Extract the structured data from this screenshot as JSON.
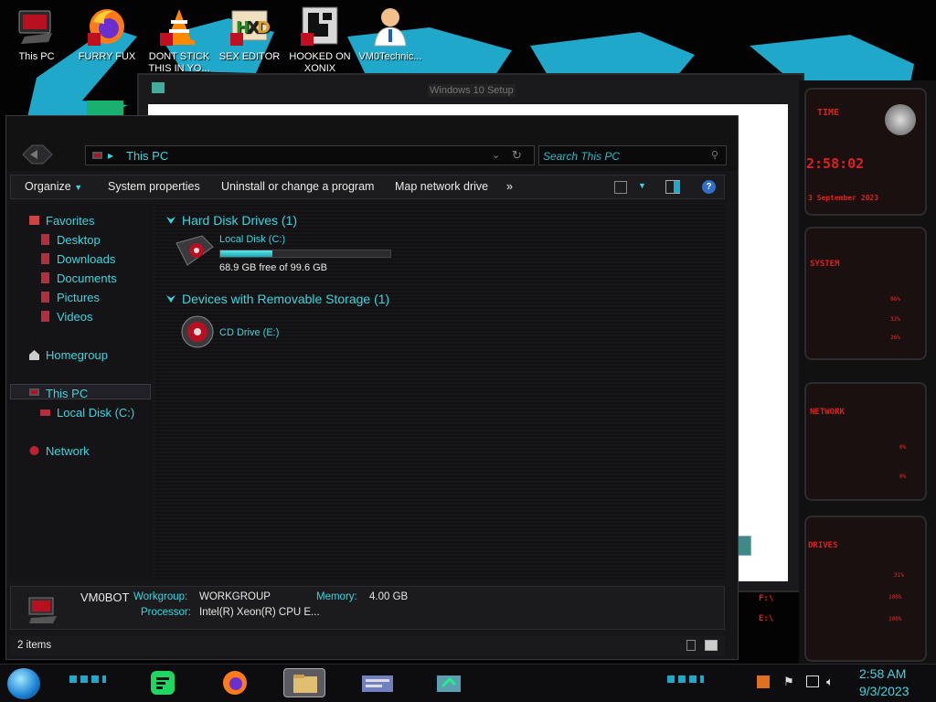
{
  "desktop": {
    "icons": [
      {
        "label": "This PC"
      },
      {
        "label": "FURRY FUX"
      },
      {
        "label": "DONT STICK THIS IN YO..."
      },
      {
        "label": "SEX EDITOR"
      },
      {
        "label": "HOOKED ON XONIX"
      },
      {
        "label": "VM0Technic..."
      }
    ]
  },
  "setup_window": {
    "title": "Windows 10 Setup"
  },
  "gadget": {
    "time_label": "TIME",
    "time": "2:58:02",
    "date": "3 September 2023",
    "system_label": "SYSTEM",
    "system_vals": [
      "86%",
      "32%",
      "26%"
    ],
    "network_label": "NETWORK",
    "network_vals": [
      "0%",
      "0%"
    ],
    "drives_label": "DRIVES",
    "drive_vals": [
      "31%",
      "100%",
      "100%"
    ],
    "drive_letters": [
      "F:\\",
      "E:\\"
    ]
  },
  "explorer": {
    "address": "This PC",
    "search_placeholder": "Search This PC",
    "toolbar": {
      "organize": "Organize",
      "system_properties": "System properties",
      "uninstall": "Uninstall or change a program",
      "map_drive": "Map network drive",
      "more": "»"
    },
    "nav": {
      "favorites": "Favorites",
      "desktop": "Desktop",
      "downloads": "Downloads",
      "documents": "Documents",
      "pictures": "Pictures",
      "videos": "Videos",
      "homegroup": "Homegroup",
      "this_pc": "This PC",
      "local_disk": "Local Disk (C:)",
      "network": "Network"
    },
    "groups": {
      "hdd": "Hard Disk Drives (1)",
      "removable": "Devices with Removable Storage (1)"
    },
    "drives": {
      "c_name": "Local Disk (C:)",
      "c_free": "68.9 GB free of 99.6 GB",
      "c_used_fraction": 0.308,
      "e_name": "CD Drive (E:)"
    },
    "details": {
      "pc_name": "VM0BOT",
      "workgroup_label": "Workgroup:",
      "workgroup": "WORKGROUP",
      "memory_label": "Memory:",
      "memory": "4.00 GB",
      "processor_label": "Processor:",
      "processor": "Intel(R) Xeon(R) CPU E..."
    },
    "status": "2 items"
  },
  "taskbar": {
    "time": "2:58 AM",
    "date": "9/3/2023"
  },
  "colors": {
    "accent": "#39d6e0",
    "alien_red": "#e02020"
  }
}
